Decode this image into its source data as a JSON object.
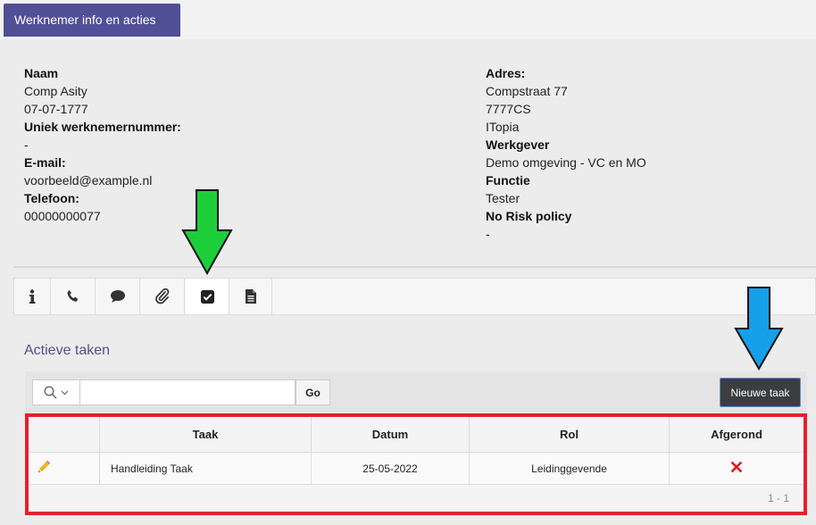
{
  "header": {
    "title": "Werknemer info en acties"
  },
  "employee": {
    "left": [
      {
        "label": "Naam",
        "values": [
          "Comp Asity",
          "07-07-1777"
        ]
      },
      {
        "label": "Uniek werknemernummer:",
        "values": [
          "-"
        ]
      },
      {
        "label": "E-mail:",
        "values": [
          "voorbeeld@example.nl"
        ]
      },
      {
        "label": "Telefoon:",
        "values": [
          "00000000077"
        ]
      }
    ],
    "right": [
      {
        "label": "Adres:",
        "values": [
          "Compstraat 77",
          "7777CS",
          "ITopia"
        ]
      },
      {
        "label": "Werkgever",
        "values": [
          "Demo omgeving - VC en MO"
        ]
      },
      {
        "label": "Functie",
        "values": [
          "Tester"
        ]
      },
      {
        "label": "No Risk policy",
        "values": [
          "-"
        ]
      }
    ]
  },
  "tabs": [
    {
      "icon": "info-icon",
      "active": false
    },
    {
      "icon": "phone-icon",
      "active": false
    },
    {
      "icon": "comment-icon",
      "active": false
    },
    {
      "icon": "paperclip-icon",
      "active": false
    },
    {
      "icon": "checkbox-icon",
      "active": true
    },
    {
      "icon": "document-icon",
      "active": false
    }
  ],
  "tasks": {
    "section_title": "Actieve taken",
    "search": {
      "value": "",
      "placeholder": ""
    },
    "go_label": "Go",
    "new_label": "Nieuwe taak",
    "columns": [
      "",
      "Taak",
      "Datum",
      "Rol",
      "Afgerond"
    ],
    "rows": [
      {
        "edit_icon": "pencil-icon",
        "taak": "Handleiding Taak",
        "datum": "25-05-2022",
        "rol": "Leidinggevende",
        "afgerond_icon": "x-icon"
      }
    ],
    "pager": "1 - 1"
  },
  "colors": {
    "header_tab": "#514f96",
    "section_title": "#52508e",
    "highlight_border": "#e2222b",
    "green_arrow": "#1ccf3a",
    "blue_arrow": "#17a0ea",
    "cross": "#e01b1b"
  }
}
